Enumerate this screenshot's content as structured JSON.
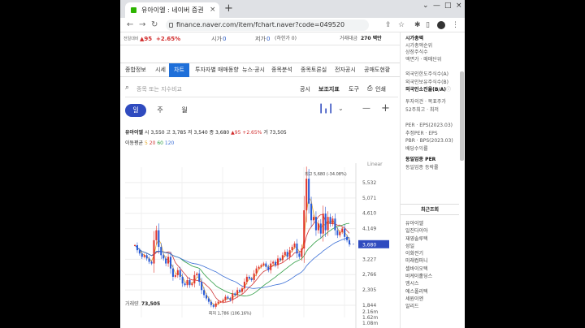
{
  "tab": {
    "title": "유아이엘 : 네이버 증권",
    "close": "×",
    "new": "+"
  },
  "window": {
    "min": "—",
    "max": "□",
    "close": "×"
  },
  "address": {
    "back": "←",
    "forward": "→",
    "reload": "↻",
    "url": "finance.naver.com/item/fchart.naver?code=049520"
  },
  "info_bar": {
    "prev_label": "전일대비",
    "change": "▲95",
    "change_pct": "+2.65%",
    "open_label": "시가",
    "open_value": "0",
    "low_label": "저가",
    "low_value": "0",
    "low_extra": "(하한가 0)",
    "vol_label": "거래대금",
    "vol_value": "270 백만"
  },
  "menu": [
    "종합정보",
    "시세",
    "차트",
    "투자자별 매매동향",
    "뉴스·공시",
    "종목분석",
    "종목토론실",
    "전자공시",
    "공매도현황"
  ],
  "search": {
    "placeholder": "종목 또는 지수비교",
    "links": [
      "공시",
      "보조지표",
      "도구",
      "인쇄"
    ]
  },
  "periods": [
    "일",
    "주",
    "월"
  ],
  "period_tools": {
    "minus": "—",
    "plus": "+"
  },
  "quote": {
    "name": "유아이엘",
    "open": "시 3,550",
    "high": "고 3,785",
    "low": "저 3,540",
    "close": "종 3,680",
    "change": "▲95 +2.65%",
    "volume": "거 73,505"
  },
  "ma": {
    "label": "이동평균",
    "v5": "5",
    "v20": "20",
    "v60": "60",
    "v120": "120"
  },
  "chart_data": {
    "type": "line",
    "scale": "Linear",
    "y_ticks": [
      "5,532",
      "5,071",
      "4,610",
      "4,149",
      "3,227",
      "2,766",
      "2,305",
      "1,844"
    ],
    "y_tick_values": [
      5532,
      5071,
      4610,
      4149,
      3227,
      2766,
      2305,
      1844
    ],
    "ylim": [
      1600,
      5750
    ],
    "current_price": "3,680",
    "current_value": 3680,
    "high_annotation": "최고 5,680 (-34.08%)",
    "high_value": 5680,
    "low_annotation": "최저 1,786 (106.16%)",
    "low_value": 1786,
    "series": [
      {
        "values": [
          3650,
          3500,
          3400,
          3300,
          3350,
          3250,
          3150,
          3100,
          3800,
          4100,
          3600,
          3350,
          3250,
          3100,
          3300,
          2950,
          2700,
          2750,
          2900,
          2700,
          2500,
          2450,
          2600,
          2450,
          2500,
          2750,
          2800,
          2550,
          2300,
          2150,
          2050,
          1950,
          1850,
          1800,
          1900,
          1950,
          1950,
          2000,
          2100,
          2050,
          2000,
          2200,
          2150,
          2300,
          2250,
          2350,
          2550,
          2700,
          2650,
          2600,
          2800,
          2950,
          3000,
          3050,
          3100,
          3000,
          2900,
          3100,
          3150,
          3050,
          3250,
          3200,
          3350,
          3450,
          3300,
          3500,
          3600,
          3700,
          3400,
          3300,
          3550,
          4700,
          5650,
          4900,
          4400,
          4500,
          4100,
          4300,
          4000,
          4600,
          4100,
          4500,
          4300,
          4450,
          4100,
          3950,
          4050,
          4150,
          3900,
          3800,
          3680
        ]
      }
    ],
    "volume_label": "거래량",
    "volume_value": "73,505",
    "volume_ticks": [
      "2.16m",
      "1.62m",
      "1.08m"
    ]
  },
  "sidebar": {
    "top": [
      {
        "text": "시가총액",
        "bold": true
      },
      {
        "text": "시가총액순위"
      },
      {
        "text": "상장주식수"
      },
      {
        "text": "액면가 · 매매단위"
      }
    ],
    "foreign": [
      {
        "text": "외국인한도주식수(A)"
      },
      {
        "text": "외국인보유주식수(B)"
      },
      {
        "text": "외국인소진율(B/A)",
        "icon": "ⓘ",
        "bold": true
      }
    ],
    "opinion": [
      {
        "text": "투자의견 · 목표주가"
      },
      {
        "text": "52주최고 · 최저"
      }
    ],
    "ratios": [
      {
        "text": "PER · EPS(2023.03)"
      },
      {
        "text": "추정PER · EPS"
      },
      {
        "text": "PBR · BPS(2023.03)"
      },
      {
        "text": "배당수익률"
      }
    ],
    "industry": [
      {
        "text": "동일업종 PER",
        "bold": true
      },
      {
        "text": "동일업종 등락률"
      }
    ],
    "recent_header": "최근조회",
    "recent": [
      "유아이엘",
      "일진다이아",
      "재영솔루텍",
      "성일",
      "이화전기",
      "미래컴퍼니",
      "셀바이오텍",
      "비케이홀딩스",
      "엠시스",
      "에스폴리텍",
      "세원이엔",
      "알리드"
    ]
  }
}
